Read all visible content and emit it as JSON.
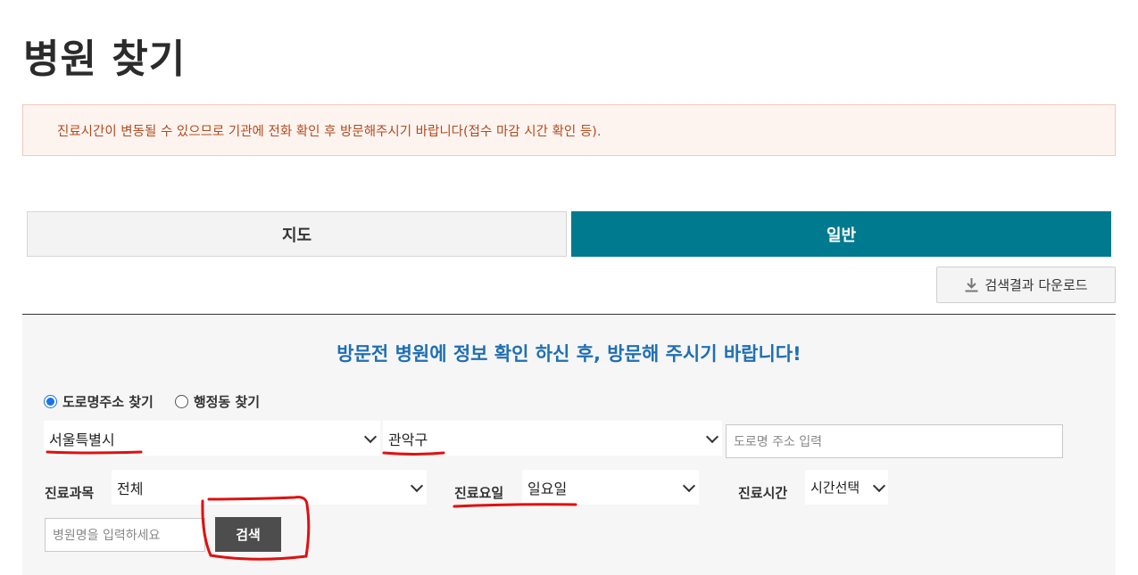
{
  "page": {
    "title": "병원 찾기"
  },
  "notice": {
    "text": "진료시간이 변동될 수 있으므로 기관에 전화 확인 후 방문해주시기 바랍니다(접수 마감 시간 확인 등)."
  },
  "tabs": [
    {
      "label": "지도",
      "active": false
    },
    {
      "label": "일반",
      "active": true
    }
  ],
  "toolbar": {
    "download_label": "검색결과 다운로드",
    "download_icon": "download-icon"
  },
  "search": {
    "heading": "방문전 병원에 정보 확인 하신 후, 방문해 주시기 바랍니다!",
    "address_mode": [
      {
        "label": "도로명주소 찾기",
        "checked": true
      },
      {
        "label": "행정동 찾기",
        "checked": false
      }
    ],
    "city": "서울특별시",
    "district": "관악구",
    "road_placeholder": "도로명 주소 입력",
    "department_label": "진료과목",
    "department_value": "전체",
    "day_label": "진료요일",
    "day_value": "일요일",
    "time_label": "진료시간",
    "time_value": "시간선택",
    "hospital_placeholder": "병원명을 입력하세요",
    "search_label": "검색"
  },
  "colors": {
    "accent": "#007a8f",
    "heading_blue": "#1f6fb2",
    "notice_text": "#b24a1e",
    "notice_bg": "#fdf4f0",
    "annotation_red": "#e01010",
    "button_dark": "#4d4d4d"
  }
}
